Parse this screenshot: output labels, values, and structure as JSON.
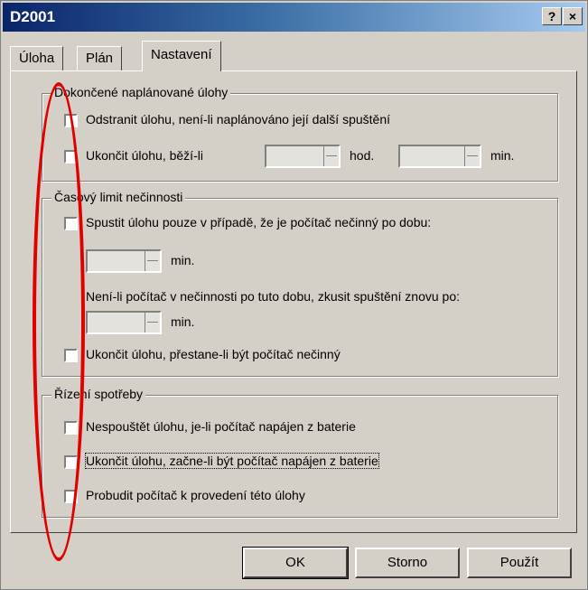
{
  "window": {
    "title": "D2001",
    "help_label": "?",
    "close_label": "×"
  },
  "tabs": [
    {
      "label": "Úloha"
    },
    {
      "label": "Plán"
    },
    {
      "label": "Nastavení"
    }
  ],
  "groups": {
    "completed": {
      "legend": "Dokončené naplánované úlohy",
      "delete_task_label": "Odstranit úlohu, není-li naplánováno její další spuštění",
      "stop_task_label": "Ukončit úlohu, běží-li",
      "hours_unit": "hod.",
      "minutes_unit": "min."
    },
    "idle": {
      "legend": "Časový limit nečinnosti",
      "start_if_idle_label": "Spustit úlohu pouze v případě, že je počítač nečinný po dobu:",
      "idle_minutes_unit": "min.",
      "retry_label": "Není-li počítač v nečinnosti po tuto dobu, zkusit spuštění znovu po:",
      "retry_minutes_unit": "min.",
      "stop_when_busy_label": "Ukončit úlohu, přestane-li být počítač nečinný"
    },
    "power": {
      "legend": "Řízení spotřeby",
      "no_battery_start_label": "Nespouštět úlohu, je-li počítač napájen z baterie",
      "stop_on_battery_label": "Ukončit úlohu, začne-li být počítač napájen z baterie",
      "wake_label": "Probudit počítač k provedení této úlohy"
    }
  },
  "buttons": {
    "ok": "OK",
    "cancel": "Storno",
    "apply": "Použít"
  },
  "colors": {
    "title_start": "#0a246a",
    "face": "#d4d0c8",
    "annotation": "#e00000"
  }
}
